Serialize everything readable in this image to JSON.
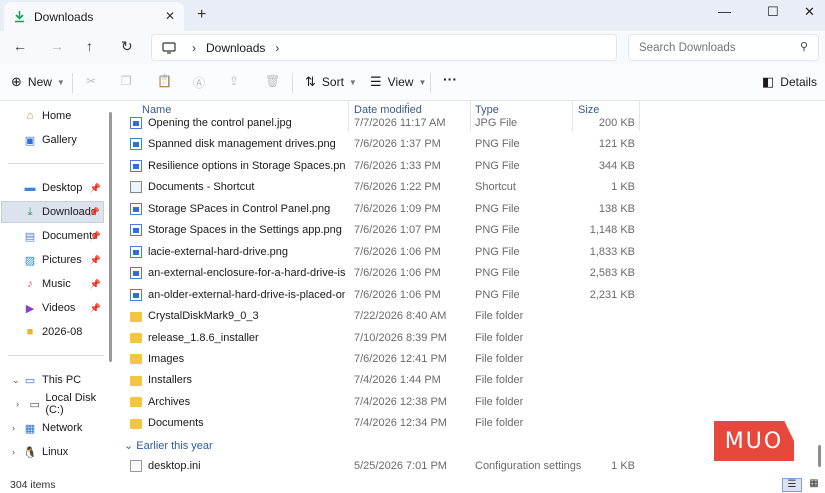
{
  "window": {
    "tab_title": "Downloads",
    "icons": {
      "tab": "download-icon",
      "close": "close-icon",
      "new_tab": "plus-icon",
      "minimize": "minimize-icon",
      "maximize": "maximize-icon",
      "window_close": "close-icon"
    }
  },
  "address": {
    "crumb": "Downloads",
    "search_placeholder": "Search Downloads"
  },
  "toolbar": {
    "new_label": "New",
    "sort_label": "Sort",
    "view_label": "View",
    "more_label": "···",
    "details_label": "Details"
  },
  "sidebar": {
    "items": [
      {
        "label": "Home",
        "icon": "home-icon"
      },
      {
        "label": "Gallery",
        "icon": "gallery-icon"
      },
      {
        "label": "Desktop",
        "icon": "desktop-icon"
      },
      {
        "label": "Downloads",
        "icon": "download-icon"
      },
      {
        "label": "Documents",
        "icon": "documents-icon"
      },
      {
        "label": "Pictures",
        "icon": "pictures-icon"
      },
      {
        "label": "Music",
        "icon": "music-icon"
      },
      {
        "label": "Videos",
        "icon": "videos-icon"
      },
      {
        "label": "2026-08",
        "icon": "folder-icon"
      },
      {
        "label": "This PC",
        "icon": "pc-icon"
      },
      {
        "label": "Local Disk (C:)",
        "icon": "drive-icon"
      },
      {
        "label": "Network",
        "icon": "network-icon"
      },
      {
        "label": "Linux",
        "icon": "linux-icon"
      }
    ]
  },
  "columns": {
    "name": "Name",
    "date": "Date modified",
    "type": "Type",
    "size": "Size"
  },
  "files": [
    {
      "name": "Opening the control panel.jpg",
      "date": "7/7/2026 11:17 AM",
      "type": "JPG File",
      "size": "200 KB",
      "icon": "image-file-icon"
    },
    {
      "name": "Spanned disk management drives.png",
      "date": "7/6/2026 1:37 PM",
      "type": "PNG File",
      "size": "121 KB",
      "icon": "image-file-icon"
    },
    {
      "name": "Resilience options in Storage Spaces.png",
      "date": "7/6/2026 1:33 PM",
      "type": "PNG File",
      "size": "344 KB",
      "icon": "image-file-icon"
    },
    {
      "name": "Documents - Shortcut",
      "date": "7/6/2026 1:22 PM",
      "type": "Shortcut",
      "size": "1 KB",
      "icon": "shortcut-icon"
    },
    {
      "name": "Storage SPaces in Control Panel.png",
      "date": "7/6/2026 1:09 PM",
      "type": "PNG File",
      "size": "138 KB",
      "icon": "image-file-icon"
    },
    {
      "name": "Storage Spaces in the Settings app.png",
      "date": "7/6/2026 1:07 PM",
      "type": "PNG File",
      "size": "1,148 KB",
      "icon": "image-file-icon"
    },
    {
      "name": "lacie-external-hard-drive.png",
      "date": "7/6/2026 1:06 PM",
      "type": "PNG File",
      "size": "1,833 KB",
      "icon": "image-file-icon"
    },
    {
      "name": "an-external-enclosure-for-a-hard-drive-is-place...",
      "date": "7/6/2026 1:06 PM",
      "type": "PNG File",
      "size": "2,583 KB",
      "icon": "image-file-icon"
    },
    {
      "name": "an-older-external-hard-drive-is-placed-on-a-de...",
      "date": "7/6/2026 1:06 PM",
      "type": "PNG File",
      "size": "2,231 KB",
      "icon": "image-file-icon"
    },
    {
      "name": "CrystalDiskMark9_0_3",
      "date": "7/22/2026 8:40 AM",
      "type": "File folder",
      "size": "",
      "icon": "folder-icon"
    },
    {
      "name": "release_1.8.6_installer",
      "date": "7/10/2026 8:39 PM",
      "type": "File folder",
      "size": "",
      "icon": "folder-icon"
    },
    {
      "name": "Images",
      "date": "7/6/2026 12:41 PM",
      "type": "File folder",
      "size": "",
      "icon": "folder-icon"
    },
    {
      "name": "Installers",
      "date": "7/4/2026 1:44 PM",
      "type": "File folder",
      "size": "",
      "icon": "folder-icon"
    },
    {
      "name": "Archives",
      "date": "7/4/2026 12:38 PM",
      "type": "File folder",
      "size": "",
      "icon": "folder-icon"
    },
    {
      "name": "Documents",
      "date": "7/4/2026 12:34 PM",
      "type": "File folder",
      "size": "",
      "icon": "folder-icon"
    }
  ],
  "group_earlier": {
    "label": "Earlier this year",
    "files": [
      {
        "name": "desktop.ini",
        "date": "5/25/2026 7:01 PM",
        "type": "Configuration settings",
        "size": "1 KB",
        "icon": "settings-file-icon"
      }
    ]
  },
  "status": {
    "item_count": "304 items"
  },
  "watermark": "MUO",
  "colors": {
    "accent": "#2f6fd6",
    "folder": "#f4c542",
    "watermark": "#e8483b",
    "selected": "#dde3ee"
  }
}
